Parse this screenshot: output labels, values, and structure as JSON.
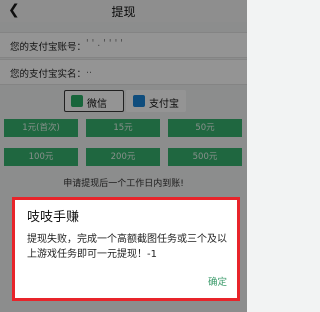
{
  "header": {
    "back_icon": "back-arrow-icon",
    "title": "提现"
  },
  "form": {
    "alipay_account_label": "您的支付宝账号：",
    "alipay_account_value": "' ' . ' ' ' '",
    "alipay_name_label": "您的支付宝实名：",
    "alipay_name_value": ".."
  },
  "payment_methods": [
    {
      "label": "微信",
      "icon": "wechat-icon",
      "selected": true,
      "color": "#2aae67"
    },
    {
      "label": "支付宝",
      "icon": "alipay-icon",
      "selected": false,
      "color": "#1b86d8"
    }
  ],
  "amounts": [
    "1元(首次)",
    "15元",
    "50元",
    "100元",
    "200元",
    "500元"
  ],
  "notice": "申请提现后一个工作日内到账!",
  "dialog": {
    "title": "吱吱手赚",
    "message": "提现失败，完成一个高额截图任务或三个及以上游戏任务即可一元提现！-1",
    "confirm_label": "确定"
  }
}
